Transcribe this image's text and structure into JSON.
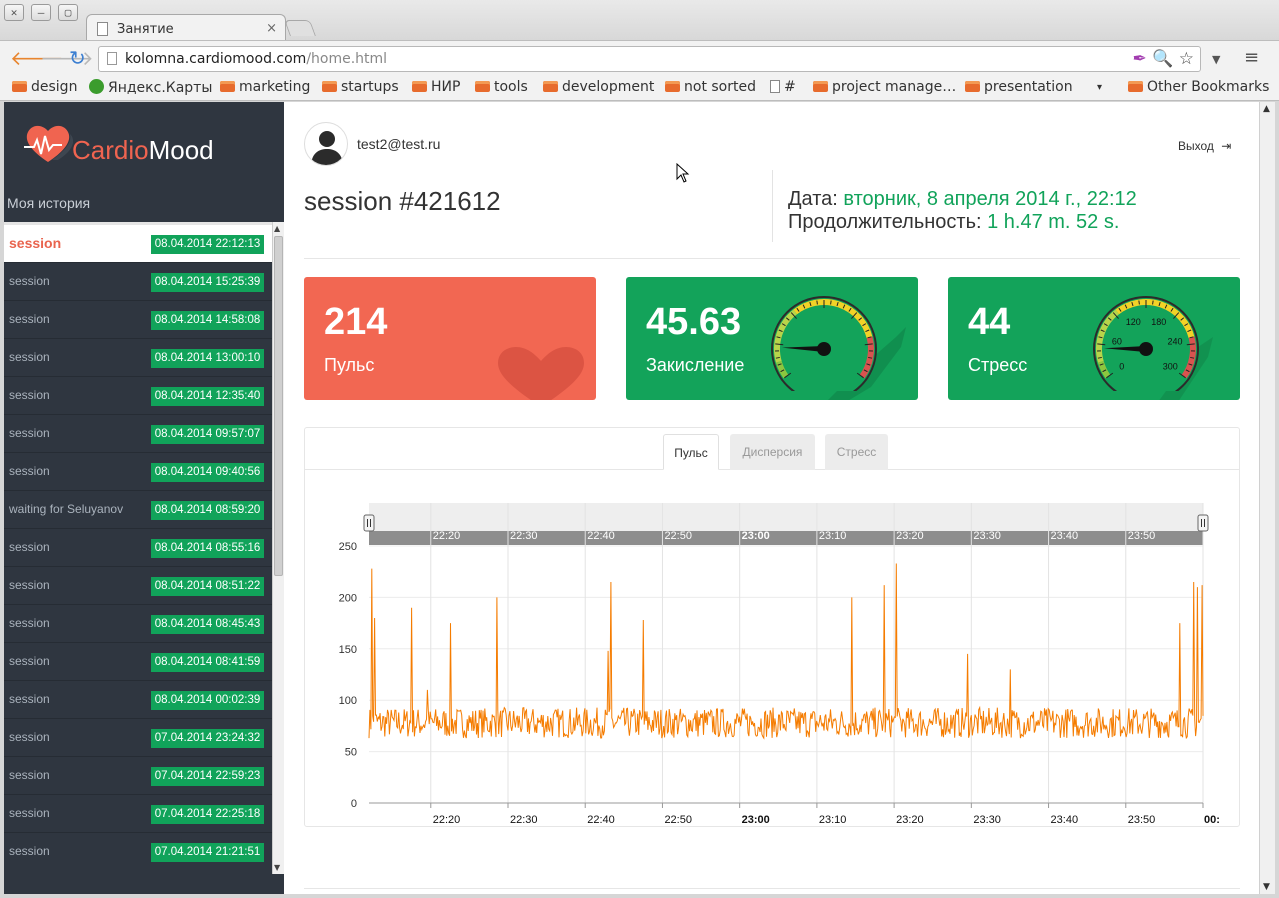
{
  "browser": {
    "tab_title": "Занятие",
    "tab_close": "×",
    "url_host": "kolomna.cardiomood.com",
    "url_path": "/home.html",
    "bookmarks": [
      {
        "label": "design",
        "icon": "folder-icon"
      },
      {
        "label": "Яндекс.Карты",
        "icon": "yandex-icon"
      },
      {
        "label": "marketing",
        "icon": "folder-icon"
      },
      {
        "label": "startups",
        "icon": "folder-icon"
      },
      {
        "label": "НИР",
        "icon": "folder-icon"
      },
      {
        "label": "tools",
        "icon": "folder-icon"
      },
      {
        "label": "development",
        "icon": "folder-icon"
      },
      {
        "label": "not sorted",
        "icon": "folder-icon"
      },
      {
        "label": "#",
        "icon": "page-icon"
      },
      {
        "label": "project manage…",
        "icon": "folder-icon"
      },
      {
        "label": "presentation",
        "icon": "folder-icon"
      },
      {
        "label": "Other Bookmarks",
        "icon": "folder-icon"
      }
    ],
    "bookmarks_overflow": "▾"
  },
  "sidebar": {
    "brand_prefix": "Cardio",
    "brand_suffix": "Mood",
    "history_title": "Моя история",
    "sessions": [
      {
        "name": "session",
        "date": "08.04.2014 22:12:13",
        "active": true
      },
      {
        "name": "session",
        "date": "08.04.2014 15:25:39"
      },
      {
        "name": "session",
        "date": "08.04.2014 14:58:08"
      },
      {
        "name": "session",
        "date": "08.04.2014 13:00:10"
      },
      {
        "name": "session",
        "date": "08.04.2014 12:35:40"
      },
      {
        "name": "session",
        "date": "08.04.2014 09:57:07"
      },
      {
        "name": "session",
        "date": "08.04.2014 09:40:56"
      },
      {
        "name": "waiting for Seluyanov",
        "date": "08.04.2014 08:59:20"
      },
      {
        "name": "session",
        "date": "08.04.2014 08:55:16"
      },
      {
        "name": "session",
        "date": "08.04.2014 08:51:22"
      },
      {
        "name": "session",
        "date": "08.04.2014 08:45:43"
      },
      {
        "name": "session",
        "date": "08.04.2014 08:41:59"
      },
      {
        "name": "session",
        "date": "08.04.2014 00:02:39"
      },
      {
        "name": "session",
        "date": "07.04.2014 23:24:32"
      },
      {
        "name": "session",
        "date": "07.04.2014 22:59:23"
      },
      {
        "name": "session",
        "date": "07.04.2014 22:25:18"
      },
      {
        "name": "session",
        "date": "07.04.2014 21:21:51"
      }
    ]
  },
  "header": {
    "user_email": "test2@test.ru",
    "logout_label": "Выход",
    "session_title": "session #421612",
    "date_label": "Дата:",
    "date_value": "вторник, 8 апреля 2014 г., 22:12",
    "duration_label": "Продолжительность:",
    "duration_value": "1 h.47 m. 52 s."
  },
  "cards": {
    "pulse": {
      "value": "214",
      "label": "Пульс",
      "color": "#f26752"
    },
    "acid": {
      "value": "45.63",
      "label": "Закисление",
      "color": "#13a35a",
      "gauge_level": 0.15
    },
    "stress": {
      "value": "44",
      "label": "Стресс",
      "color": "#13a35a",
      "gauge_ticks": [
        "0",
        "60",
        "120",
        "180",
        "240",
        "300"
      ],
      "gauge_value": 44
    }
  },
  "chart_tabs": [
    {
      "label": "Пульс",
      "active": true
    },
    {
      "label": "Дисперсия",
      "active": false
    },
    {
      "label": "Стресс",
      "active": false
    }
  ],
  "chart_data": {
    "type": "line",
    "series": [
      {
        "color": "#f57c00"
      }
    ],
    "ylim": [
      0,
      250
    ],
    "y_ticks": [
      "0",
      "50",
      "100",
      "150",
      "200",
      "250"
    ],
    "x_ticks": [
      "22:20",
      "22:30",
      "22:40",
      "22:50",
      "23:00",
      "23:10",
      "23:20",
      "23:30",
      "23:40",
      "23:50",
      "00:"
    ],
    "navigator_ticks": [
      "22:20",
      "22:30",
      "22:40",
      "22:50",
      "23:00",
      "23:10",
      "23:20",
      "23:30",
      "23:40",
      "23:50"
    ],
    "x_range": [
      "22:12",
      "00:00"
    ],
    "baseline_approx": 78,
    "noise_range": [
      60,
      95
    ],
    "spikes": [
      {
        "t": "22:12:20",
        "v": 228
      },
      {
        "t": "22:12:40",
        "v": 180
      },
      {
        "t": "22:17:30",
        "v": 190
      },
      {
        "t": "22:19:30",
        "v": 110
      },
      {
        "t": "22:22:30",
        "v": 175
      },
      {
        "t": "22:28:30",
        "v": 200
      },
      {
        "t": "22:43:00",
        "v": 148
      },
      {
        "t": "22:43:20",
        "v": 215
      },
      {
        "t": "22:47:30",
        "v": 178
      },
      {
        "t": "23:14:30",
        "v": 200
      },
      {
        "t": "23:18:40",
        "v": 212
      },
      {
        "t": "23:20:20",
        "v": 233
      },
      {
        "t": "23:29:30",
        "v": 145
      },
      {
        "t": "23:35:00",
        "v": 130
      },
      {
        "t": "23:57:00",
        "v": 175
      },
      {
        "t": "23:58:50",
        "v": 215
      },
      {
        "t": "23:59:20",
        "v": 210
      },
      {
        "t": "23:59:50",
        "v": 212
      }
    ]
  }
}
